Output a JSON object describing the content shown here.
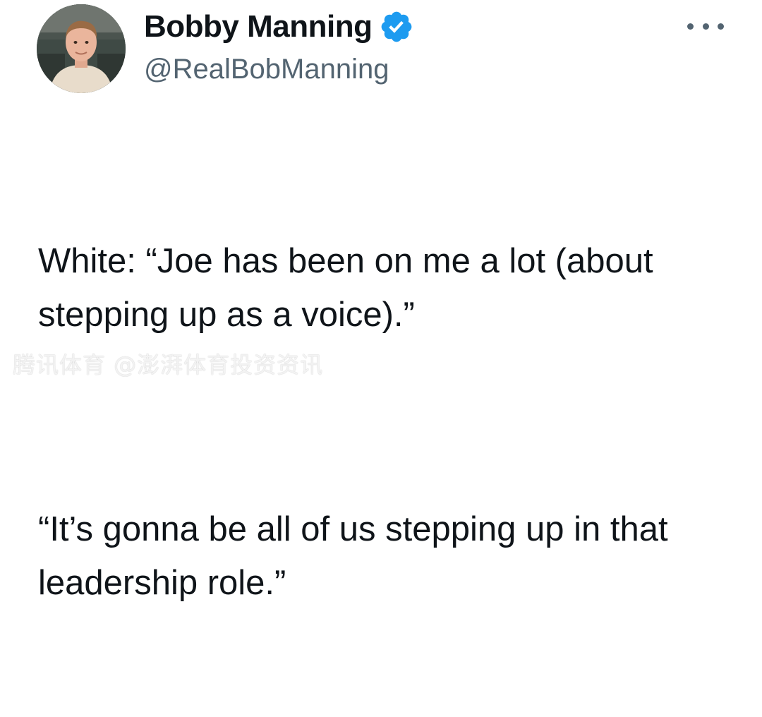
{
  "author": {
    "display_name": "Bobby Manning",
    "handle": "@RealBobManning",
    "verified": true,
    "verified_color": "#1d9bf0"
  },
  "tweet": {
    "paragraphs": [
      "White: “Joe has been on me a lot (about stepping up as a voice).”",
      "“It’s gonna be all of us stepping up in that leadership role.”"
    ]
  },
  "menu": {
    "icon": "more-horizontal-icon"
  },
  "overlay": {
    "watermark": "腾讯体育 @澎湃体育投资资讯"
  },
  "colors": {
    "text": "#0f1419",
    "secondary_text": "#536471",
    "background": "#ffffff"
  }
}
